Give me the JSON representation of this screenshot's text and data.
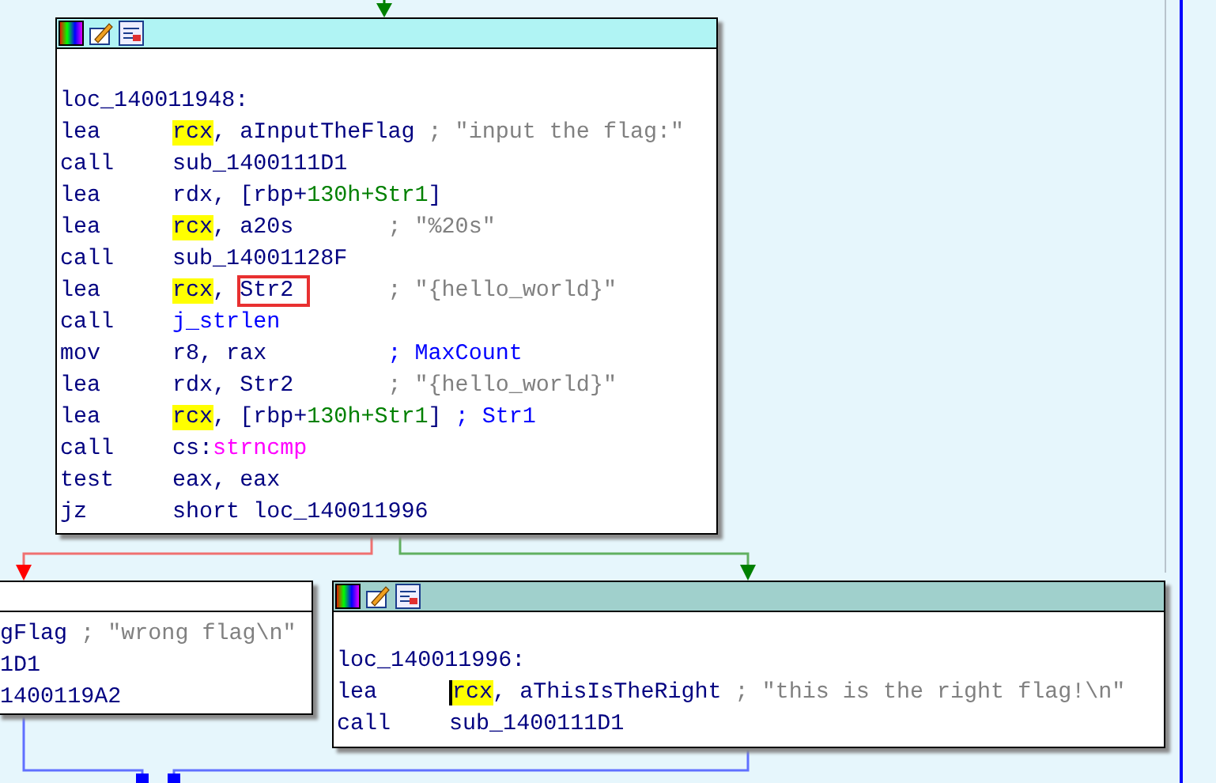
{
  "blocks": [
    {
      "kind": "full",
      "color": "#b0f4f4",
      "lines": [
        {
          "kind": "blank"
        },
        {
          "kind": "label",
          "tokens": [
            {
              "t": "loc_140011948:",
              "kind": "text"
            }
          ]
        },
        {
          "kind": "insn",
          "mnemonic": "lea",
          "tokens": [
            {
              "t": "rcx",
              "kind": "hl"
            },
            {
              "t": ", aInputTheFlag ",
              "kind": "text"
            },
            {
              "t": "; \"input the flag:\"",
              "kind": "cmt"
            }
          ]
        },
        {
          "kind": "insn",
          "mnemonic": "call",
          "tokens": [
            {
              "t": "sub_1400111D1",
              "kind": "text"
            }
          ]
        },
        {
          "kind": "insn",
          "mnemonic": "lea",
          "tokens": [
            {
              "t": "rdx, [rbp+",
              "kind": "text"
            },
            {
              "t": "130h+Str1",
              "kind": "num"
            },
            {
              "t": "]",
              "kind": "text"
            }
          ]
        },
        {
          "kind": "insn",
          "mnemonic": "lea",
          "tokens": [
            {
              "t": "rcx",
              "kind": "hl"
            },
            {
              "t": ", a20s       ",
              "kind": "text"
            },
            {
              "t": "; \"%20s\"",
              "kind": "cmt"
            }
          ]
        },
        {
          "kind": "insn",
          "mnemonic": "call",
          "tokens": [
            {
              "t": "sub_14001128F",
              "kind": "text"
            }
          ]
        },
        {
          "kind": "insn",
          "mnemonic": "lea",
          "tokens": [
            {
              "t": "rcx",
              "kind": "hl"
            },
            {
              "t": ", ",
              "kind": "text"
            },
            {
              "t": "Str2 ",
              "kind": "text",
              "boxed": true
            },
            {
              "t": "      ; \"{hello_world}\"",
              "kind": "cmt"
            }
          ]
        },
        {
          "kind": "insn",
          "mnemonic": "call",
          "tokens": [
            {
              "t": "j_strlen",
              "kind": "ref"
            }
          ]
        },
        {
          "kind": "insn",
          "mnemonic": "mov",
          "tokens": [
            {
              "t": "r8, rax         ",
              "kind": "text"
            },
            {
              "t": "; ",
              "kind": "ref"
            },
            {
              "t": "MaxCount",
              "kind": "ref"
            }
          ]
        },
        {
          "kind": "insn",
          "mnemonic": "lea",
          "tokens": [
            {
              "t": "rdx, Str2       ",
              "kind": "text"
            },
            {
              "t": "; \"{hello_world}\"",
              "kind": "cmt"
            }
          ]
        },
        {
          "kind": "insn",
          "mnemonic": "lea",
          "tokens": [
            {
              "t": "rcx",
              "kind": "hl"
            },
            {
              "t": ", [rbp+",
              "kind": "text"
            },
            {
              "t": "130h+Str1",
              "kind": "num"
            },
            {
              "t": "] ",
              "kind": "text"
            },
            {
              "t": "; Str1",
              "kind": "ref"
            }
          ]
        },
        {
          "kind": "insn",
          "mnemonic": "call",
          "tokens": [
            {
              "t": "cs:",
              "kind": "text"
            },
            {
              "t": "strncmp",
              "kind": "imp"
            }
          ]
        },
        {
          "kind": "insn",
          "mnemonic": "test",
          "tokens": [
            {
              "t": "eax, eax",
              "kind": "text"
            }
          ]
        },
        {
          "kind": "insn",
          "mnemonic": "jz",
          "tokens": [
            {
              "t": "short loc_140011996",
              "kind": "text"
            }
          ]
        }
      ]
    },
    {
      "kind": "clipped",
      "color": "#ffffff",
      "lines": [
        {
          "kind": "label",
          "tokens": [
            {
              "t": "gFlag ",
              "kind": "text"
            },
            {
              "t": "; \"wrong flag\\n\"",
              "kind": "cmt"
            }
          ]
        },
        {
          "kind": "label",
          "tokens": [
            {
              "t": "1D1",
              "kind": "text"
            }
          ]
        },
        {
          "kind": "label",
          "tokens": [
            {
              "t": "1400119A2",
              "kind": "text"
            }
          ]
        }
      ]
    },
    {
      "kind": "full",
      "color": "#a0d0cc",
      "lines": [
        {
          "kind": "blank"
        },
        {
          "kind": "label",
          "tokens": [
            {
              "t": "loc_140011996:",
              "kind": "text"
            }
          ]
        },
        {
          "kind": "insn",
          "mnemonic": "lea",
          "tokens": [
            {
              "t": "rcx",
              "kind": "hl",
              "cursor": true
            },
            {
              "t": ", aThisIsTheRight ",
              "kind": "text"
            },
            {
              "t": "; \"this is the right flag!\\n\"",
              "kind": "cmt"
            }
          ]
        },
        {
          "kind": "insn",
          "mnemonic": "call",
          "tokens": [
            {
              "t": "sub_1400111D1",
              "kind": "text"
            }
          ]
        }
      ]
    }
  ]
}
